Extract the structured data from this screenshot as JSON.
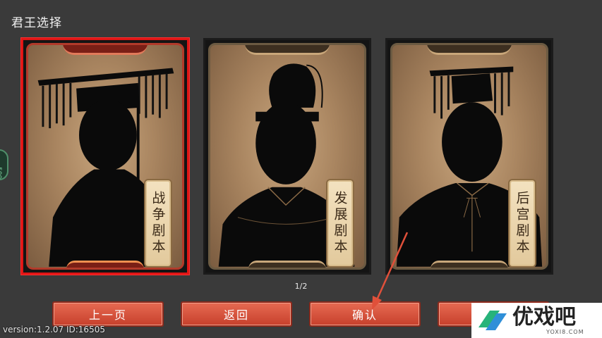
{
  "header": {
    "title": "君王选择"
  },
  "side_badge": {
    "text": "500"
  },
  "cards": [
    {
      "label": "战争剧本",
      "selected": true
    },
    {
      "label": "发展剧本",
      "selected": false
    },
    {
      "label": "后宫剧本",
      "selected": false
    }
  ],
  "pager": {
    "text": "1/2"
  },
  "buttons": {
    "prev_label": "上一页",
    "back_label": "返回",
    "confirm_label": "确认",
    "fourth_label": ""
  },
  "footer": {
    "version_text": "version:1.2.07  ID:16505"
  },
  "watermark": {
    "name": "优戏吧",
    "url": "YOXI8.COM"
  },
  "colors": {
    "selected_border": "#e01515",
    "button": "#d9553e",
    "annotation_arrow": "#e0503a",
    "watermark_accent": "#27b37a"
  }
}
